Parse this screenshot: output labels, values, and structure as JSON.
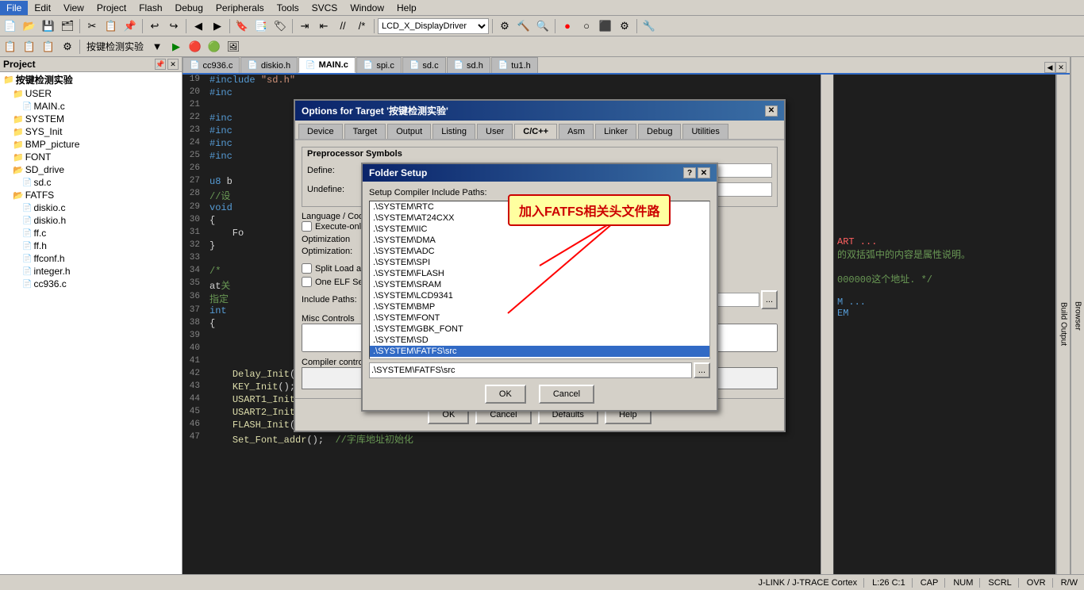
{
  "menubar": {
    "items": [
      "File",
      "Edit",
      "View",
      "Project",
      "Flash",
      "Debug",
      "Peripherals",
      "Tools",
      "SVCS",
      "Window",
      "Help"
    ]
  },
  "toolbar": {
    "project_dropdown": "LCD_X_DisplayDriver"
  },
  "toolbar2": {
    "project_name": "按键检测实验"
  },
  "tabs": [
    {
      "label": "cc936.c",
      "active": false
    },
    {
      "label": "diskio.h",
      "active": false
    },
    {
      "label": "MAIN.c",
      "active": true
    },
    {
      "label": "spi.c",
      "active": false
    },
    {
      "label": "sd.c",
      "active": false
    },
    {
      "label": "sd.h",
      "active": false
    },
    {
      "label": "tu1.h",
      "active": false
    }
  ],
  "sidebar": {
    "title": "Project",
    "root": "按键检测实验",
    "tree": [
      {
        "label": "按键检测实验",
        "level": 0,
        "type": "root",
        "expanded": true
      },
      {
        "label": "USER",
        "level": 1,
        "type": "folder",
        "expanded": true
      },
      {
        "label": "MAIN.c",
        "level": 2,
        "type": "file"
      },
      {
        "label": "SYSTEM",
        "level": 1,
        "type": "folder",
        "expanded": true
      },
      {
        "label": "SYS_Init",
        "level": 1,
        "type": "folder",
        "expanded": false
      },
      {
        "label": "BMP_picture",
        "level": 1,
        "type": "folder",
        "expanded": false
      },
      {
        "label": "FONT",
        "level": 1,
        "type": "folder",
        "expanded": false
      },
      {
        "label": "SD_drive",
        "level": 1,
        "type": "folder",
        "expanded": true
      },
      {
        "label": "sd.c",
        "level": 2,
        "type": "file"
      },
      {
        "label": "FATFS",
        "level": 1,
        "type": "folder",
        "expanded": true
      },
      {
        "label": "diskio.c",
        "level": 2,
        "type": "file"
      },
      {
        "label": "diskio.h",
        "level": 2,
        "type": "file"
      },
      {
        "label": "ff.c",
        "level": 2,
        "type": "file"
      },
      {
        "label": "ff.h",
        "level": 2,
        "type": "file"
      },
      {
        "label": "ffconf.h",
        "level": 2,
        "type": "file"
      },
      {
        "label": "integer.h",
        "level": 2,
        "type": "file"
      },
      {
        "label": "cc936.c",
        "level": 2,
        "type": "file"
      }
    ]
  },
  "code": [
    {
      "num": "19",
      "content": "#include \"sd.h\"",
      "type": "include"
    },
    {
      "num": "20",
      "content": "#inc",
      "type": "include"
    },
    {
      "num": "21",
      "content": "",
      "type": "blank"
    },
    {
      "num": "22",
      "content": "#inc",
      "type": "include"
    },
    {
      "num": "23",
      "content": "#inc",
      "type": "include"
    },
    {
      "num": "24",
      "content": "#inc",
      "type": "include"
    },
    {
      "num": "25",
      "content": "#inc",
      "type": "include"
    },
    {
      "num": "26",
      "content": "",
      "type": "blank"
    },
    {
      "num": "27",
      "content": "u8 b",
      "type": "code"
    },
    {
      "num": "28",
      "content": "//设",
      "type": "comment"
    },
    {
      "num": "29",
      "content": "void",
      "type": "code"
    },
    {
      "num": "30",
      "content": "{",
      "type": "code"
    },
    {
      "num": "31",
      "content": "    Fo",
      "type": "code"
    },
    {
      "num": "32",
      "content": "}",
      "type": "code"
    },
    {
      "num": "33",
      "content": "",
      "type": "blank"
    },
    {
      "num": "34",
      "content": "/*",
      "type": "comment"
    },
    {
      "num": "35",
      "content": "at关",
      "type": "code"
    },
    {
      "num": "36",
      "content": "指定",
      "type": "code"
    },
    {
      "num": "37",
      "content": "int",
      "type": "code"
    },
    {
      "num": "38",
      "content": "{",
      "type": "code"
    },
    {
      "num": "39",
      "content": "",
      "type": "blank"
    },
    {
      "num": "40",
      "content": "",
      "type": "blank"
    },
    {
      "num": "41",
      "content": "",
      "type": "blank"
    },
    {
      "num": "42",
      "content": "    Delay_Init();",
      "type": "code"
    },
    {
      "num": "43",
      "content": "    KEY_Init();",
      "type": "code"
    },
    {
      "num": "44",
      "content": "    USART1_Init(72,115200);",
      "type": "code"
    },
    {
      "num": "45",
      "content": "    USART2_Init(36,9600);",
      "type": "code"
    },
    {
      "num": "46",
      "content": "    FLASH_Init();",
      "type": "code"
    },
    {
      "num": "47",
      "content": "    Set_Font_addr();    //字库地址初始化",
      "type": "code"
    }
  ],
  "right_panel_top": "Build Output",
  "right_panel_right": "Browser",
  "options_dialog": {
    "title": "Options for Target '按键检测实验'",
    "tabs": [
      "Device",
      "Target",
      "Output",
      "Listing",
      "User",
      "C/C++",
      "Asm",
      "Linker",
      "Debug",
      "Utilities"
    ],
    "active_tab": "C/C++",
    "preproc_label": "Preprocessor Symbols",
    "define_label": "Define:",
    "undefine_label": "Undefine:",
    "language_label": "Language / Code Generation",
    "exec_only_label": "Execute-only Code",
    "optimization_label": "Optimization",
    "optim_label": "Optimization:",
    "split_label": "Split Load and Store Multiple",
    "one_elf_label": "One ELF Section per Function",
    "include_paths_label": "Include Paths:",
    "misc_label": "Misc Controls",
    "controls_label": "Compiler control string",
    "footer_btns": [
      "OK",
      "Cancel",
      "Defaults",
      "Help"
    ]
  },
  "folder_dialog": {
    "title": "Folder Setup",
    "label": "Setup Compiler Include Paths:",
    "paths": [
      ".\\SYSTEM\\RTC",
      ".\\SYSTEM\\AT24CXX",
      ".\\SYSTEM\\IIC",
      ".\\SYSTEM\\DMA",
      ".\\SYSTEM\\ADC",
      ".\\SYSTEM\\SPI",
      ".\\SYSTEM\\FLASH",
      ".\\SYSTEM\\SRAM",
      ".\\SYSTEM\\LCD9341",
      ".\\SYSTEM\\BMP",
      ".\\SYSTEM\\FONT",
      ".\\SYSTEM\\GBK_FONT",
      ".\\SYSTEM\\SD",
      ".\\SYSTEM\\FATFS\\src"
    ],
    "selected_path": ".\\SYSTEM\\FATFS\\src",
    "input_value": ".\\SYSTEM\\FATFS\\src",
    "browse_label": "...",
    "ok_label": "OK",
    "cancel_label": "Cancel"
  },
  "annotation": {
    "text": "加入FATFS相关头文件路"
  },
  "statusbar": {
    "jlink": "J-LINK / J-TRACE Cortex",
    "line_col": "L:26 C:1",
    "cap": "CAP",
    "num": "NUM",
    "scrl": "SCRL",
    "ovr": "OVR",
    "rw": "R/W"
  }
}
